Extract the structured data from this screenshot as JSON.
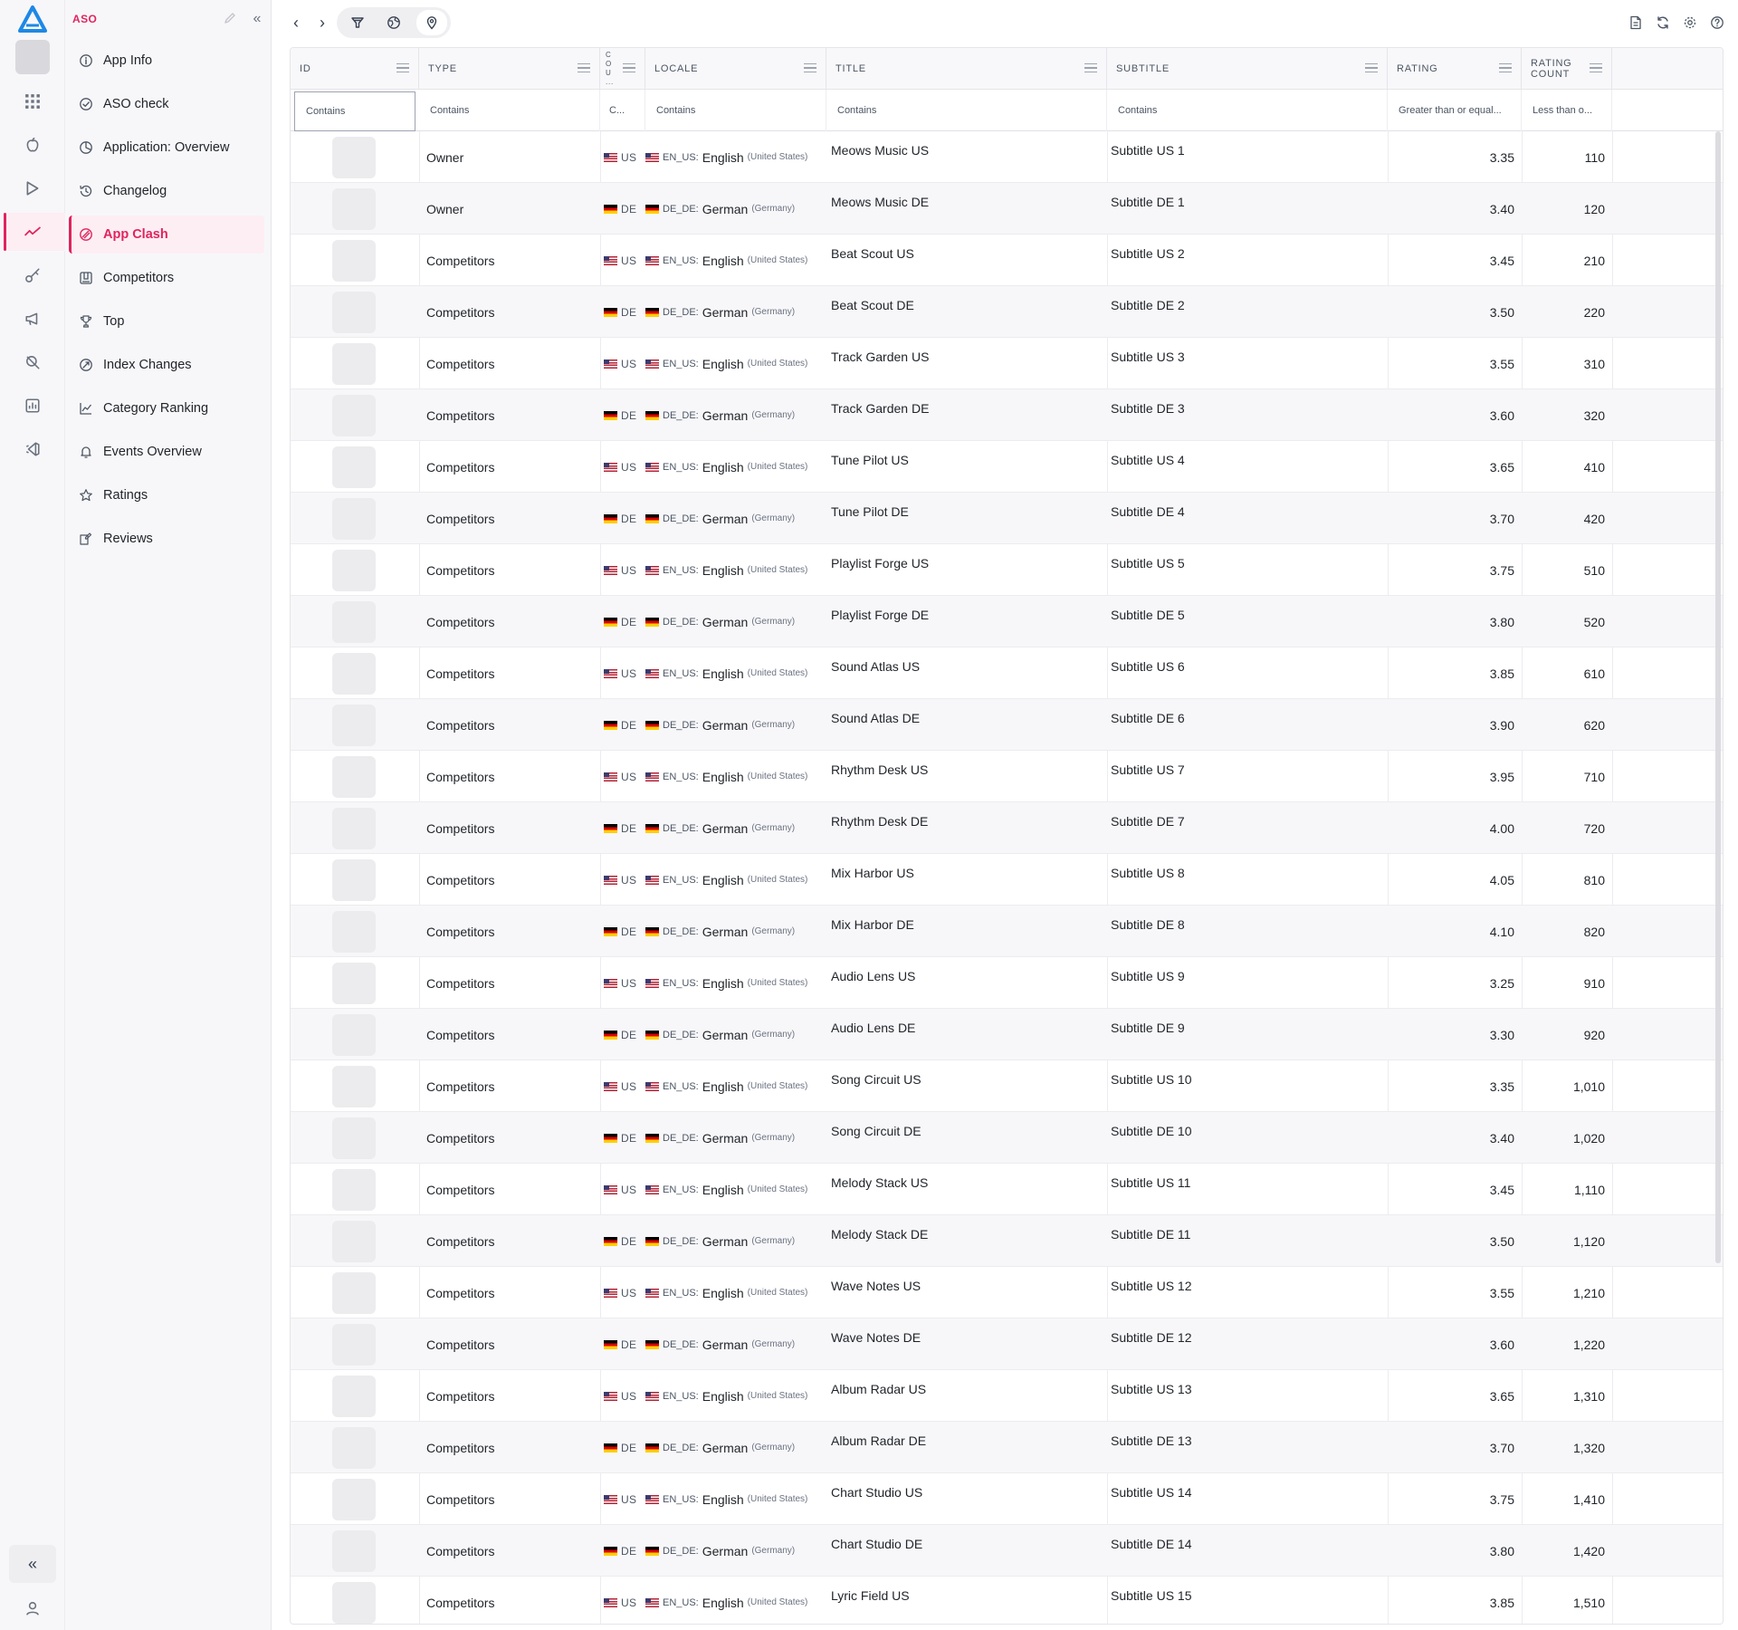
{
  "sidebar": {
    "section_label": "ASO",
    "items": [
      {
        "label": "App Info",
        "icon": "info-icon"
      },
      {
        "label": "ASO check",
        "icon": "check-circle-icon"
      },
      {
        "label": "Application: Overview",
        "icon": "pie-icon"
      },
      {
        "label": "Changelog",
        "icon": "history-icon"
      },
      {
        "label": "App Clash",
        "icon": "clash-icon",
        "active": true
      },
      {
        "label": "Competitors",
        "icon": "competitors-icon"
      },
      {
        "label": "Top",
        "icon": "trophy-icon"
      },
      {
        "label": "Index Changes",
        "icon": "index-icon"
      },
      {
        "label": "Category Ranking",
        "icon": "chart-line-icon"
      },
      {
        "label": "Events Overview",
        "icon": "bell-icon"
      },
      {
        "label": "Ratings",
        "icon": "star-icon"
      },
      {
        "label": "Reviews",
        "icon": "reviews-icon"
      }
    ]
  },
  "accent_color": "#e0245e",
  "grid": {
    "headers": {
      "id": "ID",
      "type": "TYPE",
      "country": "C O U ...",
      "locale": "LOCALE",
      "title": "TITLE",
      "subtitle": "SUBTITLE",
      "rating": "RATING",
      "rating_count_1": "RATING",
      "rating_count_2": "COUNT"
    },
    "filters": {
      "id": "Contains",
      "type": "Contains",
      "country": "C...",
      "locale": "Contains",
      "title": "Contains",
      "subtitle": "Contains",
      "rating": "Greater than or equal...",
      "rating_count": "Less than o..."
    },
    "rows": [
      {
        "type": "Owner",
        "cc": "US",
        "lcode": "EN_US:",
        "lname": "English",
        "lreg": "(United States)",
        "title": "Meows Music US",
        "subtitle": "Subtitle US 1",
        "rating": "3.35",
        "count": "110"
      },
      {
        "type": "Owner",
        "cc": "DE",
        "lcode": "DE_DE:",
        "lname": "German",
        "lreg": "(Germany)",
        "title": "Meows Music DE",
        "subtitle": "Subtitle DE 1",
        "rating": "3.40",
        "count": "120"
      },
      {
        "type": "Competitors",
        "cc": "US",
        "lcode": "EN_US:",
        "lname": "English",
        "lreg": "(United States)",
        "title": "Beat Scout US",
        "subtitle": "Subtitle US 2",
        "rating": "3.45",
        "count": "210"
      },
      {
        "type": "Competitors",
        "cc": "DE",
        "lcode": "DE_DE:",
        "lname": "German",
        "lreg": "(Germany)",
        "title": "Beat Scout DE",
        "subtitle": "Subtitle DE 2",
        "rating": "3.50",
        "count": "220"
      },
      {
        "type": "Competitors",
        "cc": "US",
        "lcode": "EN_US:",
        "lname": "English",
        "lreg": "(United States)",
        "title": "Track Garden US",
        "subtitle": "Subtitle US 3",
        "rating": "3.55",
        "count": "310"
      },
      {
        "type": "Competitors",
        "cc": "DE",
        "lcode": "DE_DE:",
        "lname": "German",
        "lreg": "(Germany)",
        "title": "Track Garden DE",
        "subtitle": "Subtitle DE 3",
        "rating": "3.60",
        "count": "320"
      },
      {
        "type": "Competitors",
        "cc": "US",
        "lcode": "EN_US:",
        "lname": "English",
        "lreg": "(United States)",
        "title": "Tune Pilot US",
        "subtitle": "Subtitle US 4",
        "rating": "3.65",
        "count": "410"
      },
      {
        "type": "Competitors",
        "cc": "DE",
        "lcode": "DE_DE:",
        "lname": "German",
        "lreg": "(Germany)",
        "title": "Tune Pilot DE",
        "subtitle": "Subtitle DE 4",
        "rating": "3.70",
        "count": "420"
      },
      {
        "type": "Competitors",
        "cc": "US",
        "lcode": "EN_US:",
        "lname": "English",
        "lreg": "(United States)",
        "title": "Playlist Forge US",
        "subtitle": "Subtitle US 5",
        "rating": "3.75",
        "count": "510"
      },
      {
        "type": "Competitors",
        "cc": "DE",
        "lcode": "DE_DE:",
        "lname": "German",
        "lreg": "(Germany)",
        "title": "Playlist Forge DE",
        "subtitle": "Subtitle DE 5",
        "rating": "3.80",
        "count": "520"
      },
      {
        "type": "Competitors",
        "cc": "US",
        "lcode": "EN_US:",
        "lname": "English",
        "lreg": "(United States)",
        "title": "Sound Atlas US",
        "subtitle": "Subtitle US 6",
        "rating": "3.85",
        "count": "610"
      },
      {
        "type": "Competitors",
        "cc": "DE",
        "lcode": "DE_DE:",
        "lname": "German",
        "lreg": "(Germany)",
        "title": "Sound Atlas DE",
        "subtitle": "Subtitle DE 6",
        "rating": "3.90",
        "count": "620"
      },
      {
        "type": "Competitors",
        "cc": "US",
        "lcode": "EN_US:",
        "lname": "English",
        "lreg": "(United States)",
        "title": "Rhythm Desk US",
        "subtitle": "Subtitle US 7",
        "rating": "3.95",
        "count": "710"
      },
      {
        "type": "Competitors",
        "cc": "DE",
        "lcode": "DE_DE:",
        "lname": "German",
        "lreg": "(Germany)",
        "title": "Rhythm Desk DE",
        "subtitle": "Subtitle DE 7",
        "rating": "4.00",
        "count": "720"
      },
      {
        "type": "Competitors",
        "cc": "US",
        "lcode": "EN_US:",
        "lname": "English",
        "lreg": "(United States)",
        "title": "Mix Harbor US",
        "subtitle": "Subtitle US 8",
        "rating": "4.05",
        "count": "810"
      },
      {
        "type": "Competitors",
        "cc": "DE",
        "lcode": "DE_DE:",
        "lname": "German",
        "lreg": "(Germany)",
        "title": "Mix Harbor DE",
        "subtitle": "Subtitle DE 8",
        "rating": "4.10",
        "count": "820"
      },
      {
        "type": "Competitors",
        "cc": "US",
        "lcode": "EN_US:",
        "lname": "English",
        "lreg": "(United States)",
        "title": "Audio Lens US",
        "subtitle": "Subtitle US 9",
        "rating": "3.25",
        "count": "910"
      },
      {
        "type": "Competitors",
        "cc": "DE",
        "lcode": "DE_DE:",
        "lname": "German",
        "lreg": "(Germany)",
        "title": "Audio Lens DE",
        "subtitle": "Subtitle DE 9",
        "rating": "3.30",
        "count": "920"
      },
      {
        "type": "Competitors",
        "cc": "US",
        "lcode": "EN_US:",
        "lname": "English",
        "lreg": "(United States)",
        "title": "Song Circuit US",
        "subtitle": "Subtitle US 10",
        "rating": "3.35",
        "count": "1,010"
      },
      {
        "type": "Competitors",
        "cc": "DE",
        "lcode": "DE_DE:",
        "lname": "German",
        "lreg": "(Germany)",
        "title": "Song Circuit DE",
        "subtitle": "Subtitle DE 10",
        "rating": "3.40",
        "count": "1,020"
      },
      {
        "type": "Competitors",
        "cc": "US",
        "lcode": "EN_US:",
        "lname": "English",
        "lreg": "(United States)",
        "title": "Melody Stack US",
        "subtitle": "Subtitle US 11",
        "rating": "3.45",
        "count": "1,110"
      },
      {
        "type": "Competitors",
        "cc": "DE",
        "lcode": "DE_DE:",
        "lname": "German",
        "lreg": "(Germany)",
        "title": "Melody Stack DE",
        "subtitle": "Subtitle DE 11",
        "rating": "3.50",
        "count": "1,120"
      },
      {
        "type": "Competitors",
        "cc": "US",
        "lcode": "EN_US:",
        "lname": "English",
        "lreg": "(United States)",
        "title": "Wave Notes US",
        "subtitle": "Subtitle US 12",
        "rating": "3.55",
        "count": "1,210"
      },
      {
        "type": "Competitors",
        "cc": "DE",
        "lcode": "DE_DE:",
        "lname": "German",
        "lreg": "(Germany)",
        "title": "Wave Notes DE",
        "subtitle": "Subtitle DE 12",
        "rating": "3.60",
        "count": "1,220"
      },
      {
        "type": "Competitors",
        "cc": "US",
        "lcode": "EN_US:",
        "lname": "English",
        "lreg": "(United States)",
        "title": "Album Radar US",
        "subtitle": "Subtitle US 13",
        "rating": "3.65",
        "count": "1,310"
      },
      {
        "type": "Competitors",
        "cc": "DE",
        "lcode": "DE_DE:",
        "lname": "German",
        "lreg": "(Germany)",
        "title": "Album Radar DE",
        "subtitle": "Subtitle DE 13",
        "rating": "3.70",
        "count": "1,320"
      },
      {
        "type": "Competitors",
        "cc": "US",
        "lcode": "EN_US:",
        "lname": "English",
        "lreg": "(United States)",
        "title": "Chart Studio US",
        "subtitle": "Subtitle US 14",
        "rating": "3.75",
        "count": "1,410"
      },
      {
        "type": "Competitors",
        "cc": "DE",
        "lcode": "DE_DE:",
        "lname": "German",
        "lreg": "(Germany)",
        "title": "Chart Studio DE",
        "subtitle": "Subtitle DE 14",
        "rating": "3.80",
        "count": "1,420"
      },
      {
        "type": "Competitors",
        "cc": "US",
        "lcode": "EN_US:",
        "lname": "English",
        "lreg": "(United States)",
        "title": "Lyric Field US",
        "subtitle": "Subtitle US 15",
        "rating": "3.85",
        "count": "1,510"
      }
    ]
  }
}
